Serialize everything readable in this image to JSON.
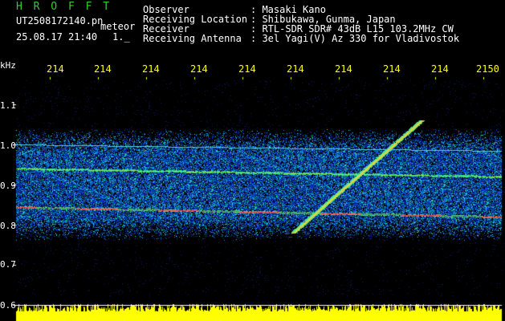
{
  "header": {
    "brand": "H R O F F T",
    "filename": "UT2508172140.pn",
    "filename_suffix": "meteor",
    "datetime": "25.08.17 21:40",
    "datetime_suffix": "1._",
    "fields": [
      {
        "label": "Observer",
        "value": ": Masaki Kano"
      },
      {
        "label": "Receiving Location",
        "value": ": Shibukawa, Gunma, Japan"
      },
      {
        "label": "Receiver",
        "value": ": RTL-SDR SDR# 43dB L15 103.2MHz CW"
      },
      {
        "label": "Receiving Antenna",
        "value": ": 3el Yagi(V) Az 330 for Vladivostok"
      }
    ]
  },
  "axis": {
    "unit": "kHz",
    "y_ticks": [
      "1.1",
      "1.0",
      "0.9",
      "0.8",
      "0.7",
      "0.6"
    ],
    "x_ticks": [
      "214",
      "214",
      "214",
      "214",
      "214",
      "214",
      "214",
      "214",
      "214",
      "2150"
    ]
  },
  "colors": {
    "brand": "#33cc33",
    "text": "#ffffff",
    "tick": "#ffff00",
    "axis_label": "#ffffff",
    "amplitude": "#ffff00",
    "background": "#000000",
    "signal": "#ff3333",
    "noise": "#1133aa"
  }
}
